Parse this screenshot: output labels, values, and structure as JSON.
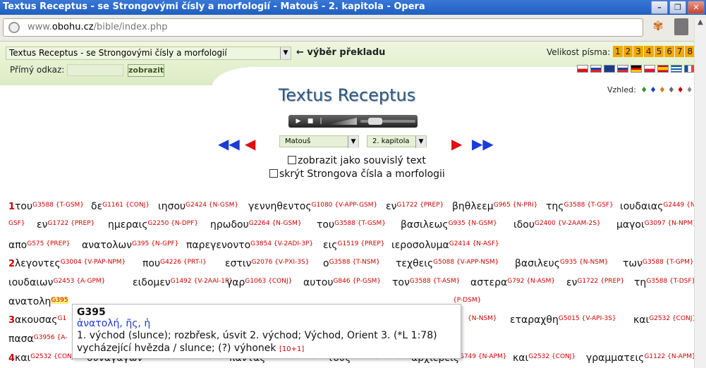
{
  "window": {
    "title": "Textus Receptus - se Strongovými čísly a morfologií - Matouš - 2. kapitola - Opera"
  },
  "browser": {
    "url_prefix": "www.",
    "url_domain": "obohu.cz",
    "url_path": "/bible/index.php"
  },
  "toolbar": {
    "translation_select": "Textus Receptus - se Strongovými čísly a morfologií",
    "translation_label": "← výběr překladu",
    "font_size_label": "Velikost písma:",
    "font_sizes": [
      "1",
      "2",
      "3",
      "4",
      "5",
      "6",
      "7",
      "8"
    ],
    "direct_link_label": "Přímý odkaz:",
    "show_button": "zobrazit"
  },
  "header": {
    "title": "Textus Receptus",
    "appearance_label": "Vzhled:",
    "appearance_dots": [
      {
        "c": "#2a9a2a"
      },
      {
        "c": "#1a3bd6"
      },
      {
        "c": "#e07a00"
      },
      {
        "c": "#666666"
      },
      {
        "c": "#c00000"
      },
      {
        "c": "#888888"
      }
    ]
  },
  "navigation": {
    "book": "Matouš",
    "chapter": "2. kapitola",
    "show_continuous": "zobrazit jako souvislý text",
    "hide_strong": "skrýt Strongova čísla a morfologii"
  },
  "verses": [
    {
      "num": "1",
      "top": 0,
      "words": [
        [
          "του",
          "G3588 {T-GSM}"
        ],
        [
          "δε",
          "G1161 {CONJ}"
        ],
        [
          "ιησου",
          "G2424 {N-GSM}"
        ],
        [
          "γεννηθεντος",
          "G1080 {V-APP-GSM}"
        ],
        [
          "εν",
          "G1722 {PREP}"
        ],
        [
          "βηθλεεμ",
          "G965 {N-PRI}"
        ],
        [
          "της",
          "G3588 {T-GSF}"
        ],
        [
          "ιουδαιας",
          "G2449 {N-"
        ]
      ]
    }
  ],
  "lines": {
    "l1": [
      "του",
      "G3588 {T-GSM}",
      "δε",
      "G1161 {CONJ}",
      "ιησου",
      "G2424 {N-GSM}",
      "γεννηθεντος",
      "G1080 {V-APP-GSM}",
      "εν",
      "G1722 {PREP}",
      "βηθλεεμ",
      "G965 {N-PRI}",
      "της",
      "G3588 {T-GSF}",
      "ιουδαιας",
      "G2449 {N-"
    ],
    "l2": [
      "GSF}",
      "εν",
      "G1722 {PREP}",
      "ημεραις",
      "G2250 {N-DPF}",
      "ηρωδου",
      "G2264 {N-GSM}",
      "του",
      "G3588 {T-GSM}",
      "βασιλεως",
      "G935 {N-GSM}",
      "ιδου",
      "G2400 {V-2AAM-2S}",
      "μαγοι",
      "G3097 {N-NPM}"
    ],
    "l3": [
      "απο",
      "G575 {PREP}",
      "ανατολων",
      "G395 {N-GPF}",
      "παρεγενοντο",
      "G3854 {V-2ADI-3P}",
      "εις",
      "G1519 {PREP}",
      "ιεροσολυμα",
      "G2414 {N-ASF}"
    ],
    "l4": [
      "λεγοντες",
      "G3004 {V-PAP-NPM}",
      "που",
      "G4226 {PRT-I}",
      "εστιν",
      "G2076 {V-PXI-3S}",
      "ο",
      "G3588 {T-NSM}",
      "τεχθεις",
      "G5088 {V-APP-NSM}",
      "βασιλευς",
      "G935 {N-NSM}",
      "των",
      "G3588 {T-GPM}"
    ],
    "l5": [
      "ιουδαιων",
      "G2453 {A-GPM}",
      "ειδομεν",
      "G1492 {V-2AAI-1P}",
      "γαρ",
      "G1063 {CONJ}",
      "αυτου",
      "G846 {P-GSM}",
      "τον",
      "G3588 {T-ASM}",
      "αστερα",
      "G792 {N-ASM}",
      "εν",
      "G1722 {PREP}",
      "τη",
      "G3588 {T-DSF}"
    ],
    "l6": [
      "ανατολη",
      "G395",
      "{P-DSM}"
    ],
    "l7": [
      "ακουσας",
      "G1",
      "{N-NSM}",
      "εταραχθη",
      "G5015 {V-API-3S}",
      "και",
      "G2532 {CONJ}"
    ],
    "l8": [
      "πασα",
      "G3956 {A-"
    ],
    "l9": [
      "και",
      "G2532 {CONJ}",
      "συναγαγων",
      "G4863 {V-2AAP-NSM}",
      "παντας",
      "G3956 {A-APM}",
      "τους",
      "G3588 {T-APM}",
      "αρχιερεις",
      "G749 {N-APM}",
      "και",
      "G2532 {CONJ}",
      "γραμματεις",
      "G1122 {N-APM}"
    ]
  },
  "verse_numbers": [
    "1",
    "2",
    "3",
    "4"
  ],
  "popup": {
    "title": "G395",
    "greek": "ἀνατολή, ῆς, ἡ",
    "definition_line1": "1. východ (slunce); rozbřesk, úsvit 2. východ; Východ, Orient 3. (*L 1:78)",
    "definition_line2": "vycházející hvězda / slunce; (?) výhonek",
    "count": "[10+1]"
  }
}
